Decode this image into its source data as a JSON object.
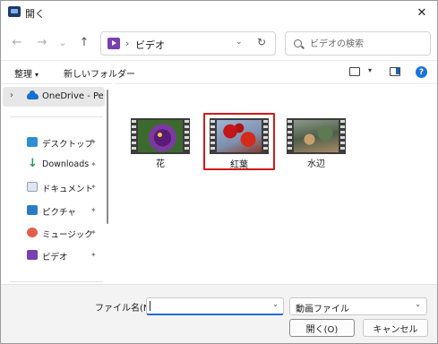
{
  "window": {
    "title": "開く",
    "close_glyph": "✕"
  },
  "nav": {
    "back_glyph": "←",
    "forward_glyph": "→",
    "recent_glyph": "⌄",
    "up_glyph": "↑",
    "address": {
      "separator": "›",
      "location": "ビデオ",
      "dropdown_glyph": "⌄"
    },
    "refresh_glyph": "↻",
    "search": {
      "placeholder": "ビデオの検索"
    }
  },
  "commandbar": {
    "organize": "整理",
    "organize_caret": "▾",
    "new_folder": "新しいフォルダー",
    "view_dropdown_glyph": "▾",
    "help_glyph": "?"
  },
  "sidebar": {
    "onedrive": {
      "chevron": "›",
      "label": "OneDrive - Perso"
    },
    "pin_glyph": "📌",
    "items": [
      {
        "label": "デスクトップ",
        "icon": "desktop-icon"
      },
      {
        "label": "Downloads",
        "icon": "download-icon"
      },
      {
        "label": "ドキュメント",
        "icon": "documents-icon"
      },
      {
        "label": "ピクチャ",
        "icon": "pictures-icon"
      },
      {
        "label": "ミュージック",
        "icon": "music-icon"
      },
      {
        "label": "ビデオ",
        "icon": "videos-icon"
      }
    ]
  },
  "files": [
    {
      "name": "花",
      "selected": false
    },
    {
      "name": "紅葉",
      "selected": true
    },
    {
      "name": "水辺",
      "selected": false
    }
  ],
  "footer": {
    "filename_label": "ファイル名(N):",
    "filename_value": "",
    "filename_dd_glyph": "⌄",
    "filetype": "動画ファイル",
    "filetype_dd_glyph": "⌄",
    "open_button": "開く(O)",
    "cancel_button": "キャンセル"
  },
  "colors": {
    "selection_border": "#d11a1a",
    "accent": "#1f6fd1",
    "video_folder": "#7a3fb0"
  }
}
